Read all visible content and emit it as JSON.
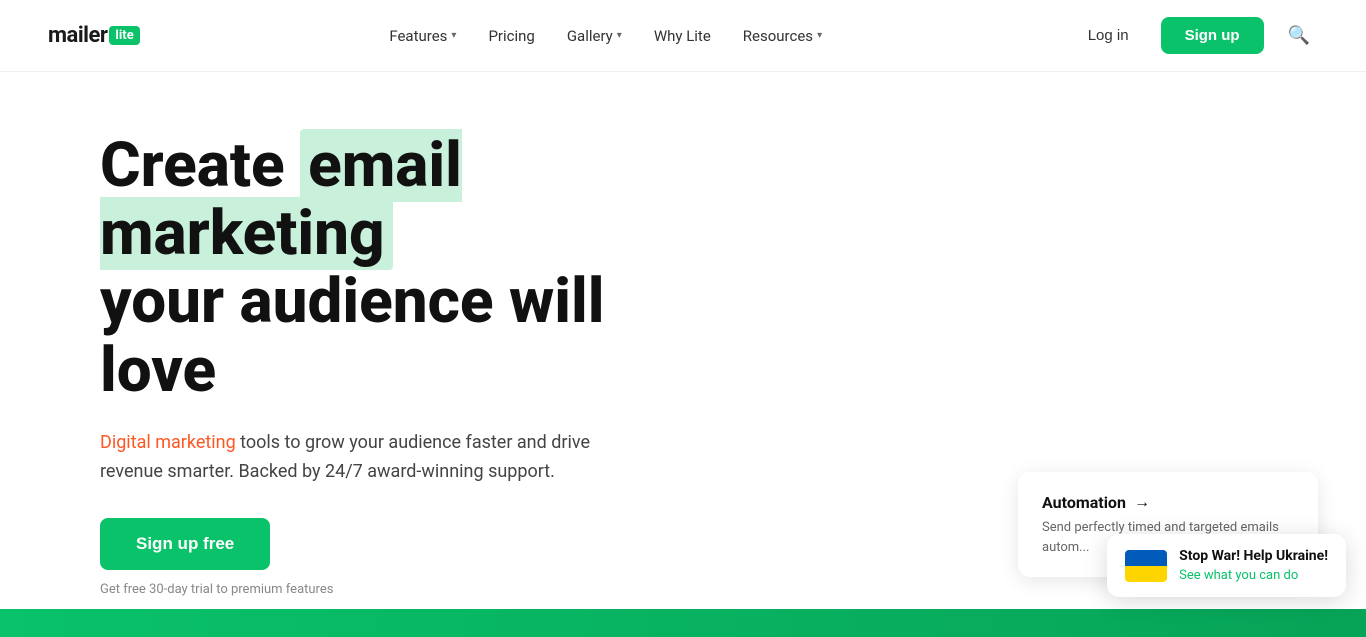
{
  "brand": {
    "mailer": "mailer",
    "lite": "lite"
  },
  "nav": {
    "items": [
      {
        "label": "Features",
        "hasDropdown": true
      },
      {
        "label": "Pricing",
        "hasDropdown": false
      },
      {
        "label": "Gallery",
        "hasDropdown": true
      },
      {
        "label": "Why Lite",
        "hasDropdown": false
      },
      {
        "label": "Resources",
        "hasDropdown": true
      }
    ]
  },
  "header": {
    "login_label": "Log in",
    "signup_label": "Sign up"
  },
  "hero": {
    "title_before": "Create",
    "title_highlight": "email marketing",
    "title_after": "your audience will love",
    "subtitle_highlight": "Digital marketing",
    "subtitle_rest": " tools to grow your audience faster and drive revenue smarter. Backed by 24/7 award-winning support.",
    "cta_label": "Sign up free",
    "trial_text": "Get free 30-day trial to premium features"
  },
  "automation": {
    "title": "Automation",
    "arrow": "→",
    "text": "Send perfectly timed and targeted emails autom..."
  },
  "ukraine_banner": {
    "title": "Stop War! Help Ukraine!",
    "link_text": "See what you can do"
  }
}
